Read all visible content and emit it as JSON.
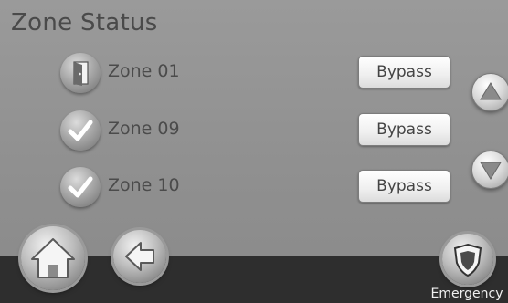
{
  "header": {
    "title": "Zone Status"
  },
  "zones": [
    {
      "label": "Zone 01",
      "status_icon": "door-open-icon",
      "action": "Bypass"
    },
    {
      "label": "Zone 09",
      "status_icon": "check-icon",
      "action": "Bypass"
    },
    {
      "label": "Zone 10",
      "status_icon": "check-icon",
      "action": "Bypass"
    }
  ],
  "scroll": {
    "up_icon": "triangle-up-icon",
    "down_icon": "triangle-down-icon"
  },
  "footer": {
    "home_icon": "home-icon",
    "back_icon": "arrow-left-icon",
    "emergency_icon": "shield-icon",
    "emergency_label": "Emergency"
  },
  "colors": {
    "screen_bg": "#8f8f8f",
    "title_text": "#4a4a4a",
    "footer_bg": "#2e2e2e",
    "button_face": "#efefef"
  }
}
